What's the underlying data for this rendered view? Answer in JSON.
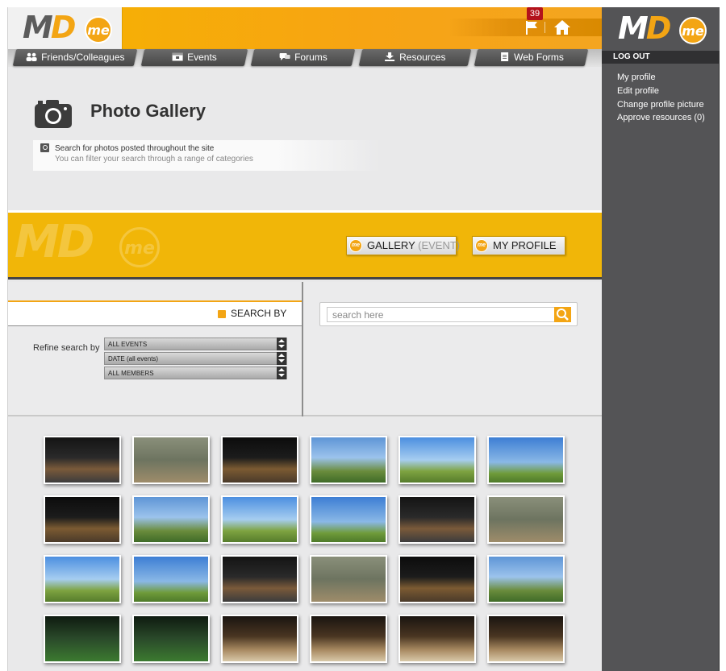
{
  "logo": {
    "text_m": "M",
    "text_d": "D",
    "badge": "me"
  },
  "header": {
    "notification_count": "39",
    "colors": {
      "accent": "#f3a514",
      "band": "#f1b608",
      "sidebar": "#545456"
    }
  },
  "nav": {
    "tabs": [
      {
        "label": "Friends/Colleagues",
        "icon": "people-icon"
      },
      {
        "label": "Events",
        "icon": "calendar-icon"
      },
      {
        "label": "Forums",
        "icon": "chat-icon"
      },
      {
        "label": "Resources",
        "icon": "download-icon"
      },
      {
        "label": "Web Forms",
        "icon": "document-icon"
      }
    ]
  },
  "page": {
    "title": "Photo Gallery",
    "hint_line1": "Search for photos posted throughout the site",
    "hint_line2": "You can filter your search through a range of categories"
  },
  "band": {
    "gallery_label": "GALLERY",
    "gallery_sub": "(EVENT)",
    "profile_label": "MY PROFILE"
  },
  "search": {
    "search_by_label": "SEARCH BY",
    "refine_label": "Refine search by",
    "selects": [
      "ALL EVENTS",
      "DATE (all events)",
      "ALL MEMBERS"
    ],
    "placeholder": "search here"
  },
  "gallery": {
    "rows": 4,
    "columns": 6
  },
  "sidebar": {
    "logout_label": "LOG OUT",
    "links": [
      "My profile",
      "Edit profile",
      "Change profile picture",
      "Approve resources (0)"
    ]
  }
}
